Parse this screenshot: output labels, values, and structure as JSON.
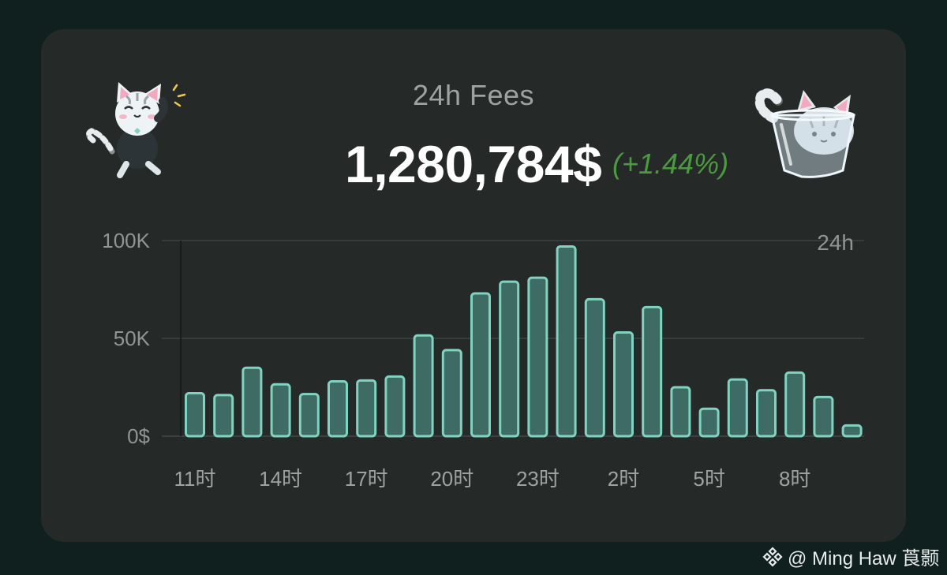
{
  "card": {
    "title": "24h Fees",
    "total": "1,280,784$",
    "change": "(+1.44%)"
  },
  "icons": {
    "left_mascot": "dancing-cat-icon",
    "right_mascot": "cat-in-cup-icon",
    "watermark": "binance-logo-icon"
  },
  "colors": {
    "bar_fill": "#3e6b63",
    "bar_stroke": "#7fd4c1",
    "change_text": "#4c9a3f"
  },
  "chart_data": {
    "type": "bar",
    "period_label": "24h",
    "ylim": [
      0,
      100000
    ],
    "yticks": [
      {
        "value": 0,
        "label": "0$"
      },
      {
        "value": 50000,
        "label": "50K"
      },
      {
        "value": 100000,
        "label": "100K"
      }
    ],
    "xtick_labels": [
      {
        "index": 0,
        "label": "11时"
      },
      {
        "index": 3,
        "label": "14时"
      },
      {
        "index": 6,
        "label": "17时"
      },
      {
        "index": 9,
        "label": "20时"
      },
      {
        "index": 12,
        "label": "23时"
      },
      {
        "index": 15,
        "label": "2时"
      },
      {
        "index": 18,
        "label": "5时"
      },
      {
        "index": 21,
        "label": "8时"
      }
    ],
    "values": [
      22000,
      21000,
      35000,
      26500,
      21500,
      28000,
      28500,
      30500,
      51500,
      44000,
      73000,
      79000,
      81000,
      97000,
      70000,
      53000,
      66000,
      25000,
      14000,
      29000,
      23500,
      32500,
      20000,
      5500
    ]
  },
  "watermark": {
    "text": "@ Ming Haw 莨颢"
  }
}
